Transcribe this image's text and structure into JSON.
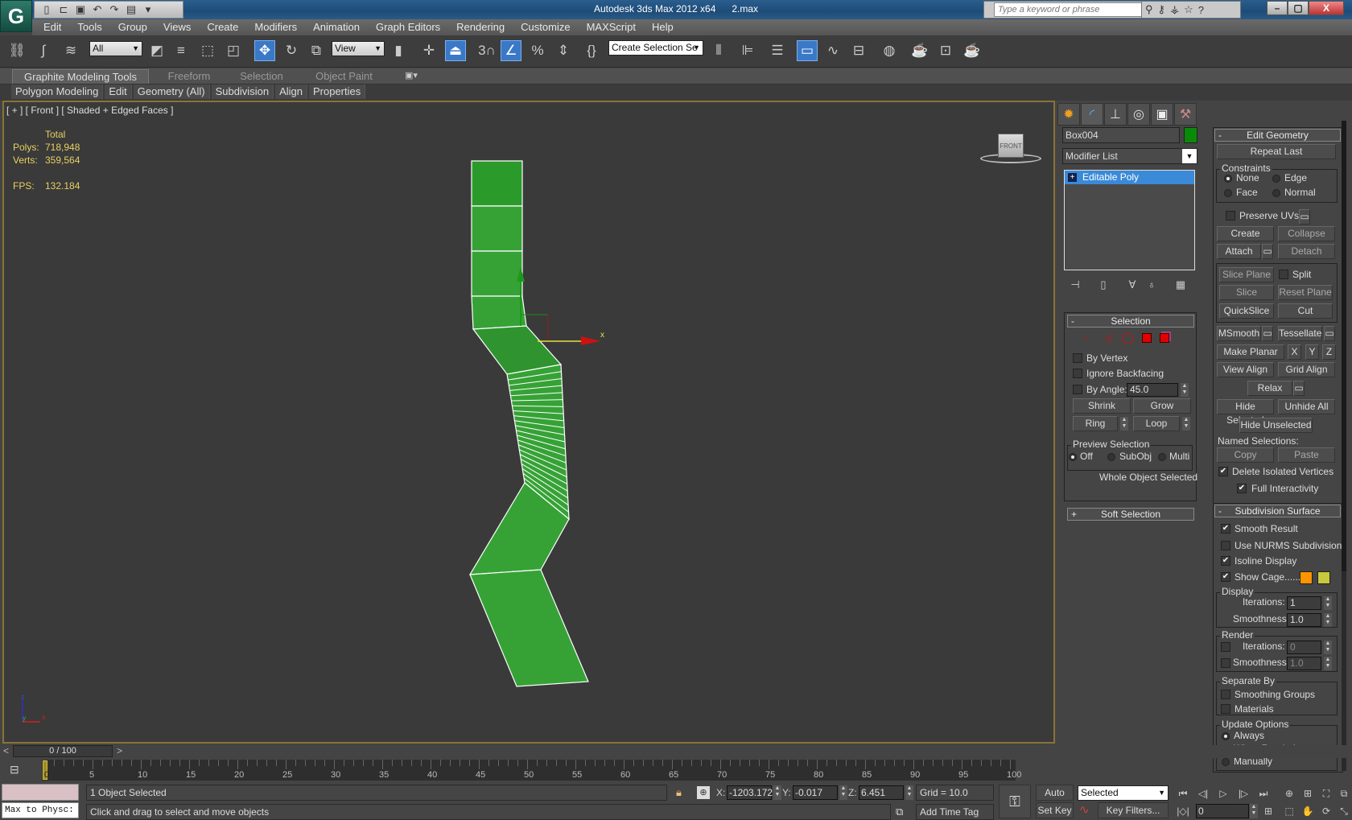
{
  "app": {
    "title": "Autodesk 3ds Max  2012 x64",
    "file": "2.max",
    "logo_icon": "3ds-max-logo-icon",
    "quick_access": [
      "new-file-icon",
      "open-file-icon",
      "save-icon",
      "undo-icon",
      "redo-icon",
      "project-folder-icon"
    ],
    "search_placeholder": "Type a keyword or phrase",
    "infocenter_icons": [
      "binoculars-icon",
      "key-icon",
      "satellite-icon",
      "star-icon",
      "help-icon"
    ],
    "window_controls": {
      "minimize": "–",
      "restore": "▢",
      "close": "X"
    }
  },
  "menu": [
    "Edit",
    "Tools",
    "Group",
    "Views",
    "Create",
    "Modifiers",
    "Animation",
    "Graph Editors",
    "Rendering",
    "Customize",
    "MAXScript",
    "Help"
  ],
  "toolbar": {
    "selection_filter": "All",
    "ref_coord": "View",
    "named_selection": "Create Selection Se",
    "icons": [
      "link-icon",
      "unlink-icon",
      "bind-space-warp-icon",
      "select-object-icon",
      "select-by-name-icon",
      "rect-selection-region-icon",
      "window-crossing-icon",
      "select-move-icon",
      "select-rotate-icon",
      "select-scale-icon",
      "use-pivot-center-icon",
      "select-manipulate-icon",
      "keyboard-shortcut-override-icon",
      "snaps-toggle-icon",
      "angle-snap-icon",
      "percent-snap-icon",
      "spinner-snap-icon",
      "edit-named-selections-icon",
      "mirror-icon",
      "align-icon",
      "layer-manager-icon",
      "graphite-toggle-icon",
      "curve-editor-icon",
      "schematic-view-icon",
      "material-editor-icon",
      "render-setup-icon",
      "rendered-frame-icon",
      "render-production-icon"
    ]
  },
  "ribbon": {
    "tabs": [
      "Graphite Modeling Tools",
      "Freeform",
      "Selection",
      "Object Paint"
    ],
    "active_tab": "Graphite Modeling Tools",
    "panels": [
      "Polygon Modeling",
      "Edit",
      "Geometry (All)",
      "Subdivision",
      "Align",
      "Properties"
    ]
  },
  "viewport": {
    "label": "[ + ] [ Front ] [ Shaded + Edged Faces ]",
    "stats": {
      "header": "Total",
      "polys_label": "Polys:",
      "polys": "718,948",
      "verts_label": "Verts:",
      "verts": "359,564",
      "fps_label": "FPS:",
      "fps": "132.184"
    },
    "viewcube_label": "FRONT",
    "gizmo_x_label": "x",
    "axis_labels": {
      "z": "z",
      "y": "y",
      "x": "x"
    },
    "mesh_color": "#36a236",
    "border_color": "#8a7434"
  },
  "command_panel": {
    "tabs": [
      "create-tab-icon",
      "modify-tab-icon",
      "hierarchy-tab-icon",
      "motion-tab-icon",
      "display-tab-icon",
      "utilities-tab-icon"
    ],
    "object_name": "Box004",
    "object_color": "#0a8a0a",
    "modifier_list": "Modifier List",
    "stack": [
      {
        "label": "Editable Poly",
        "expand": "+"
      }
    ],
    "stack_tools": [
      "pin-stack-icon",
      "show-end-result-icon",
      "make-unique-icon",
      "remove-modifier-icon",
      "configure-modifier-sets-icon"
    ],
    "selection": {
      "title": "Selection",
      "collapse": "-",
      "subobj_icons": [
        "vertex-icon",
        "edge-icon",
        "border-icon",
        "polygon-icon",
        "element-icon"
      ],
      "by_vertex": "By Vertex",
      "ignore_backfacing": "Ignore Backfacing",
      "by_angle": "By Angle:",
      "angle_value": "45.0",
      "shrink": "Shrink",
      "grow": "Grow",
      "ring": "Ring",
      "loop": "Loop",
      "preview_title": "Preview Selection",
      "preview_off": "Off",
      "preview_subobj": "SubObj",
      "preview_multi": "Multi",
      "status": "Whole Object Selected"
    },
    "soft_selection": {
      "title": "Soft Selection",
      "expand": "+"
    },
    "edit_geometry": {
      "title": "Edit Geometry",
      "collapse": "-",
      "repeat_last": "Repeat Last",
      "constraints_title": "Constraints",
      "none": "None",
      "edge": "Edge",
      "face": "Face",
      "normal": "Normal",
      "preserve_uvs": "Preserve UVs",
      "create": "Create",
      "collapse_btn": "Collapse",
      "attach": "Attach",
      "detach": "Detach",
      "slice_plane": "Slice Plane",
      "split": "Split",
      "slice": "Slice",
      "reset_plane": "Reset Plane",
      "quickslice": "QuickSlice",
      "cut": "Cut",
      "msmooth": "MSmooth",
      "tessellate": "Tessellate",
      "make_planar": "Make Planar",
      "x": "X",
      "y": "Y",
      "z": "Z",
      "view_align": "View Align",
      "grid_align": "Grid Align",
      "relax": "Relax",
      "hide_selected": "Hide Selected",
      "unhide_all": "Unhide All",
      "hide_unselected": "Hide Unselected",
      "named_selections": "Named Selections:",
      "copy": "Copy",
      "paste": "Paste",
      "delete_isolated": "Delete Isolated Vertices",
      "full_interactivity": "Full Interactivity"
    },
    "subdivision_surface": {
      "title": "Subdivision Surface",
      "collapse": "-",
      "smooth_result": "Smooth Result",
      "use_nurms": "Use NURMS Subdivision",
      "isoline_display": "Isoline Display",
      "show_cage": "Show Cage......",
      "cage_color_1": "#ff9400",
      "cage_color_2": "#c8c83c",
      "display_title": "Display",
      "iterations_label": "Iterations:",
      "display_iterations": "1",
      "smoothness_label": "Smoothness:",
      "display_smoothness": "1.0",
      "render_title": "Render",
      "render_iterations": "0",
      "render_smoothness": "1.0",
      "separate_title": "Separate By",
      "smoothing_groups": "Smoothing Groups",
      "materials": "Materials",
      "update_title": "Update Options",
      "always": "Always",
      "when_rendering": "When Rendering",
      "manually": "Manually"
    }
  },
  "timeline": {
    "slider": "0 / 100",
    "prev": "<",
    "next": ">",
    "ticks": [
      "0",
      "5",
      "10",
      "15",
      "20",
      "25",
      "30",
      "35",
      "40",
      "45",
      "50",
      "55",
      "60",
      "65",
      "70",
      "75",
      "80",
      "85",
      "90",
      "95",
      "100"
    ]
  },
  "status": {
    "listener_text": "Max to Physc:",
    "selected": "1 Object Selected",
    "prompt": "Click and drag to select and move objects",
    "x_label": "X:",
    "x": "-1203.172",
    "y_label": "Y:",
    "y": "-0.017",
    "z_label": "Z:",
    "z": "6.451",
    "grid": "Grid = 10.0",
    "add_time_tag": "Add Time Tag",
    "auto_key": "Auto Key",
    "set_key": "Set Key",
    "key_mode": "Selected",
    "key_filters": "Key Filters...",
    "current_frame": "0"
  }
}
